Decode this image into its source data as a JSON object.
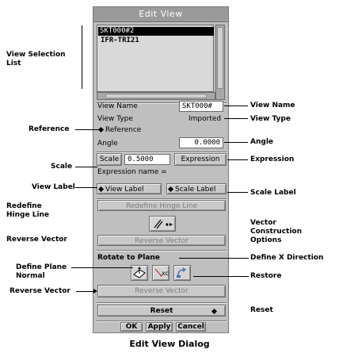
{
  "dialog": {
    "title": "Edit View",
    "views": [
      "SKT000#2",
      "IFR-TRI21"
    ],
    "view_name_label": "View Name",
    "view_name_value": "SKT000#",
    "view_type_label": "View Type",
    "view_type_value": "Imported",
    "reference_label": "Reference",
    "angle_label": "Angle",
    "angle_value": "0.0000",
    "scale_label": "Scale",
    "scale_value": "0.5000",
    "expression_button": "Expression",
    "expression_name_label": "Expression name =",
    "view_label_toggle": "View Label",
    "scale_label_toggle": "Scale Label",
    "redefine_hinge_line": "Redefine Hinge Line",
    "reverse_vector": "Reverse Vector",
    "rotate_to_plane": "Rotate to Plane",
    "reverse_vector_2": "Reverse Vector",
    "reset": "Reset",
    "ok": "OK",
    "apply": "Apply",
    "cancel": "Cancel"
  },
  "annotations": {
    "view_selection_list": "View Selection List",
    "reference": "Reference",
    "scale": "Scale",
    "view_label": "View Label",
    "redefine_hinge_line": "Redefine Hinge Line",
    "reverse_vector_1": "Reverse Vector",
    "define_plane_normal": "Define Plane Normal",
    "reverse_vector_2": "Reverse Vector",
    "view_name": "View Name",
    "view_type": "View Type",
    "angle": "Angle",
    "expression": "Expression",
    "scale_label": "Scale Label",
    "vector_construction_options": "Vector Construction Options",
    "define_x_direction": "Define X Direction",
    "restore": "Restore",
    "reset": "Reset"
  },
  "caption": "Edit View Dialog"
}
